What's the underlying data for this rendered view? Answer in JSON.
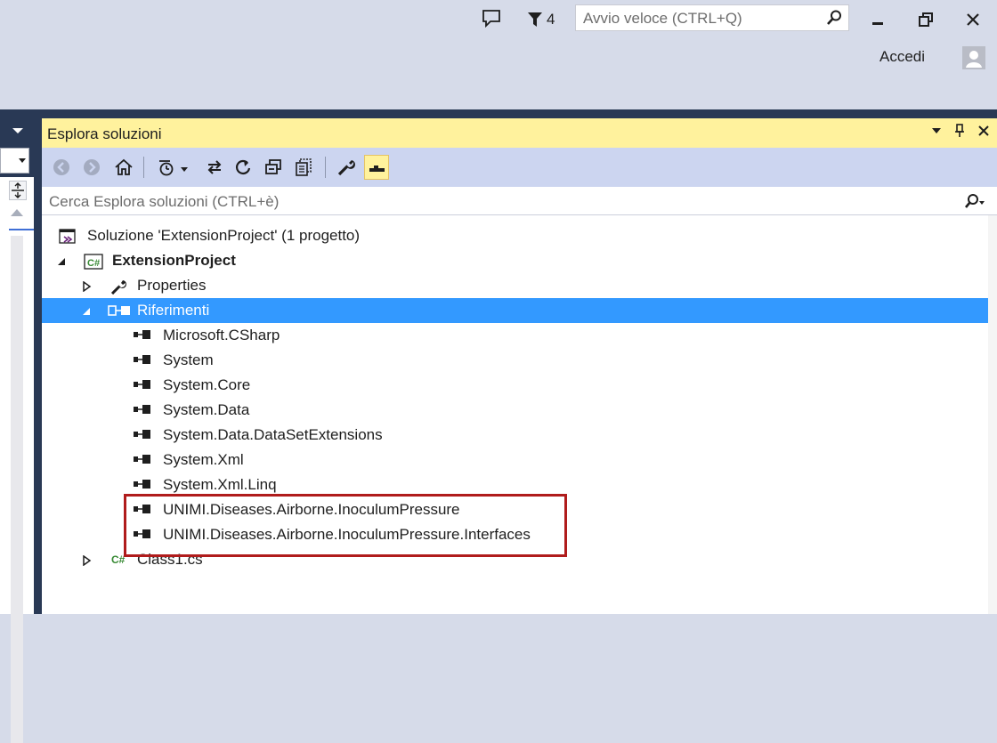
{
  "titlebar": {
    "notifications_count": "4",
    "quick_launch_placeholder": "Avvio veloce (CTRL+Q)",
    "sign_in_label": "Accedi",
    "icons": [
      "feedback-icon",
      "notification-flag-icon",
      "search-icon",
      "minimize-icon",
      "restore-icon",
      "close-icon",
      "avatar-icon"
    ]
  },
  "explorer": {
    "title": "Esplora soluzioni",
    "search_placeholder": "Cerca Esplora soluzioni (CTRL+è)",
    "toolbar_icons": [
      "back-icon",
      "forward-icon",
      "home-icon",
      "pending-changes-filter-icon",
      "sync-icon",
      "refresh-icon",
      "collapse-all-icon",
      "show-all-files-icon",
      "properties-icon",
      "preview-icon"
    ],
    "tree": {
      "solution": "Soluzione 'ExtensionProject'  (1 progetto)",
      "project": "ExtensionProject",
      "properties": "Properties",
      "references": "Riferimenti",
      "reference_items": [
        "Microsoft.CSharp",
        "System",
        "System.Core",
        "System.Data",
        "System.Data.DataSetExtensions",
        "System.Xml",
        "System.Xml.Linq",
        "UNIMI.Diseases.Airborne.InoculumPressure",
        "UNIMI.Diseases.Airborne.InoculumPressure.Interfaces"
      ],
      "file": "Class1.cs"
    }
  },
  "colors": {
    "title_bar_bg": "#d6dbe9",
    "frame_bg": "#293955",
    "explorer_title_bg": "#fff29d",
    "toolbar_bg": "#ccd5f0",
    "selection_bg": "#3399ff",
    "highlight_border": "#b01c1c"
  }
}
